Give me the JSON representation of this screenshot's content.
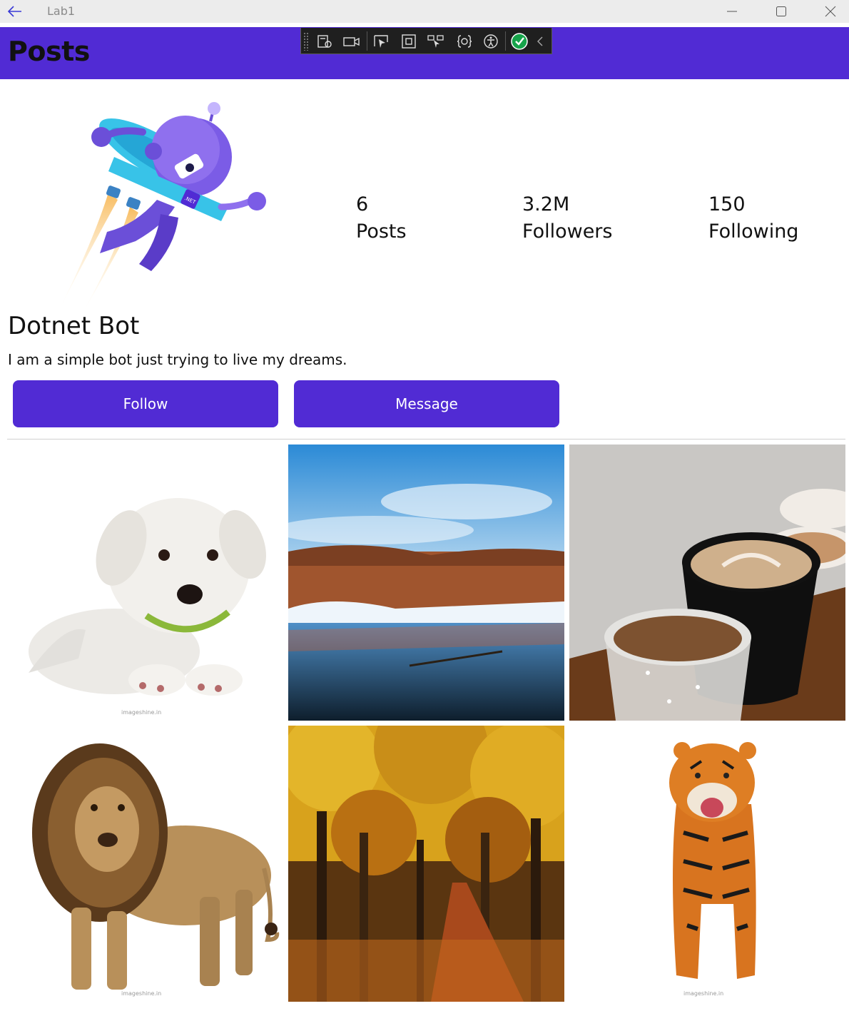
{
  "window": {
    "title": "Lab1"
  },
  "header": {
    "title": "Posts"
  },
  "profile": {
    "name": "Dotnet Bot",
    "bio": "I am a simple bot just trying to live my dreams.",
    "stats": [
      {
        "value": "6",
        "label": "Posts"
      },
      {
        "value": "3.2M",
        "label": "Followers"
      },
      {
        "value": "150",
        "label": "Following"
      }
    ],
    "avatar_badge": ".NET"
  },
  "actions": {
    "follow_label": "Follow",
    "message_label": "Message"
  },
  "posts": [
    {
      "subject": "puppy-photo",
      "watermark": "imageshine.in"
    },
    {
      "subject": "winter-river-photo"
    },
    {
      "subject": "coffee-photo"
    },
    {
      "subject": "lion-photo",
      "watermark": "imageshine.in"
    },
    {
      "subject": "autumn-forest-photo"
    },
    {
      "subject": "tiger-photo",
      "watermark": "imageshine.in"
    }
  ],
  "colors": {
    "accent": "#512bd4",
    "button_text": "#ffffff",
    "titlebar": "#ececec"
  }
}
